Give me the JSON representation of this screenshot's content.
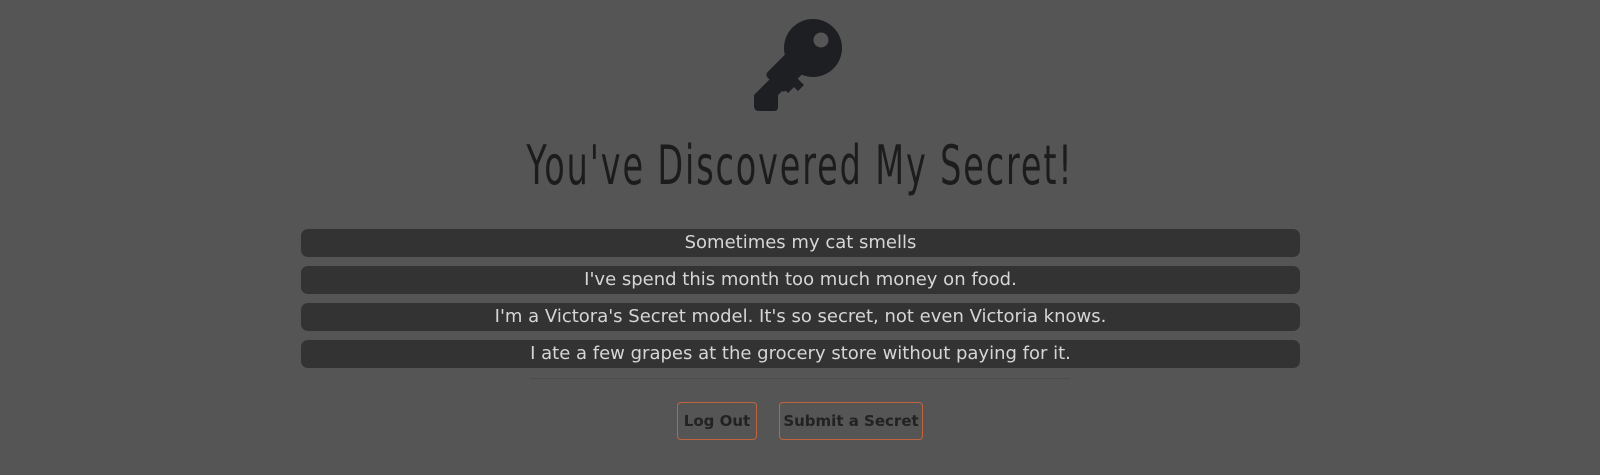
{
  "header": {
    "icon": "key-icon",
    "title": "You've Discovered My Secret!"
  },
  "secrets": [
    "Sometimes my cat smells",
    "I've spend this month too much money on food.",
    "I'm a Victora's Secret model. It's so secret, not even Victoria knows.",
    "I ate a few grapes at the grocery store without paying for it."
  ],
  "actions": {
    "logout_label": "Log Out",
    "submit_label": "Submit a Secret"
  },
  "colors": {
    "background": "#555555",
    "secret_bg": "#333333",
    "secret_text": "#d6d6d6",
    "button_border": "#c0633f",
    "dark": "#1c1c1c"
  }
}
